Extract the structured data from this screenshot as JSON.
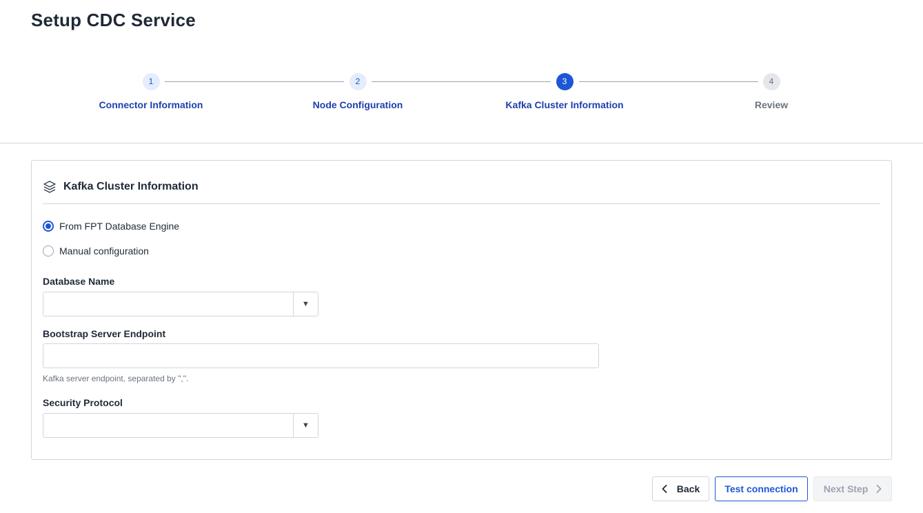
{
  "page": {
    "title": "Setup CDC Service"
  },
  "stepper": {
    "steps": [
      {
        "number": "1",
        "label": "Connector Information",
        "state": "done"
      },
      {
        "number": "2",
        "label": "Node Configuration",
        "state": "done"
      },
      {
        "number": "3",
        "label": "Kafka Cluster Information",
        "state": "active"
      },
      {
        "number": "4",
        "label": "Review",
        "state": "todo"
      }
    ]
  },
  "card": {
    "title": "Kafka Cluster Information",
    "icon": "layers-icon",
    "source_options": [
      {
        "label": "From FPT Database Engine",
        "checked": true
      },
      {
        "label": "Manual configuration",
        "checked": false
      }
    ],
    "database_name": {
      "label": "Database Name",
      "value": ""
    },
    "bootstrap": {
      "label": "Bootstrap Server Endpoint",
      "value": "",
      "hint": "Kafka server endpoint, separated by \",\"."
    },
    "security_protocol": {
      "label": "Security Protocol",
      "value": ""
    }
  },
  "footer": {
    "back_label": "Back",
    "test_label": "Test connection",
    "next_label": "Next Step"
  },
  "colors": {
    "primary": "#1d56d6",
    "step_done_bg": "#e3edfc",
    "disabled_bg": "#f3f4f6"
  }
}
